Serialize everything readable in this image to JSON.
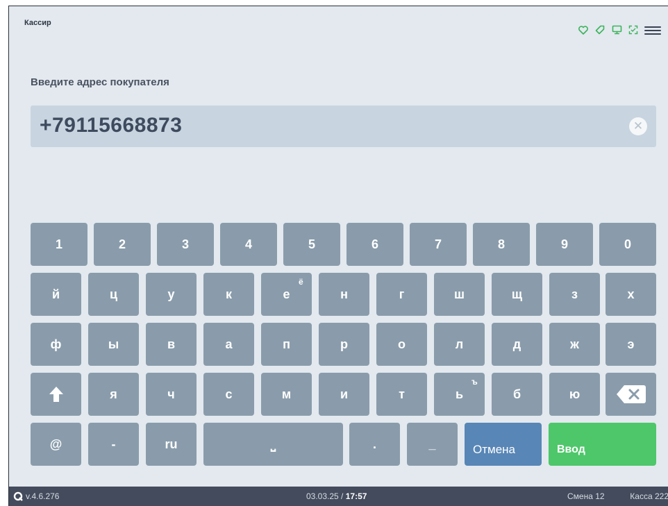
{
  "header": {
    "role": "Кассир",
    "icons": [
      "heart-icon",
      "tag-icon",
      "monitor-icon",
      "scan-icon"
    ],
    "accent_color": "#3cb35a",
    "menu_icon": "menu-icon"
  },
  "prompt": "Введите адрес покупателя",
  "input": {
    "value": "+79115668873",
    "clear_icon": "✕"
  },
  "keyboard": {
    "digits": [
      "1",
      "2",
      "3",
      "4",
      "5",
      "6",
      "7",
      "8",
      "9",
      "0"
    ],
    "row1": [
      "й",
      "ц",
      "у",
      "к",
      "е",
      "н",
      "г",
      "ш",
      "щ",
      "з",
      "х"
    ],
    "row1_sup": "ё",
    "row2": [
      "ф",
      "ы",
      "в",
      "а",
      "п",
      "р",
      "о",
      "л",
      "д",
      "ж",
      "э"
    ],
    "row3": [
      "я",
      "ч",
      "с",
      "м",
      "и",
      "т",
      "ь",
      "б",
      "ю"
    ],
    "row3_sup": "ъ",
    "bottom": {
      "at": "@",
      "dash": "-",
      "lang": "ru",
      "space": "⎵",
      "dot": ".",
      "underscore": "_",
      "cancel": "Отмена",
      "enter": "Ввод"
    },
    "key_color": "#8a9cab",
    "cancel_color": "#5886b6",
    "enter_color": "#4dc76a"
  },
  "status": {
    "version": "v.4.6.276",
    "date": "03.03.25 / ",
    "time": "17:57",
    "shift": "Смена 12",
    "register": "Касса 222"
  }
}
